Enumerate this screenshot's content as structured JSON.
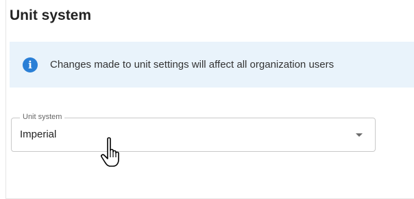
{
  "section": {
    "title": "Unit system"
  },
  "banner": {
    "icon": "info-icon",
    "message": "Changes made to unit settings will affect all organization users"
  },
  "unit_select": {
    "label": "Unit system",
    "value": "Imperial"
  },
  "colors": {
    "banner_bg": "#e9f3fb",
    "info_icon": "#2a7fd6",
    "border": "#c9c9c9"
  }
}
